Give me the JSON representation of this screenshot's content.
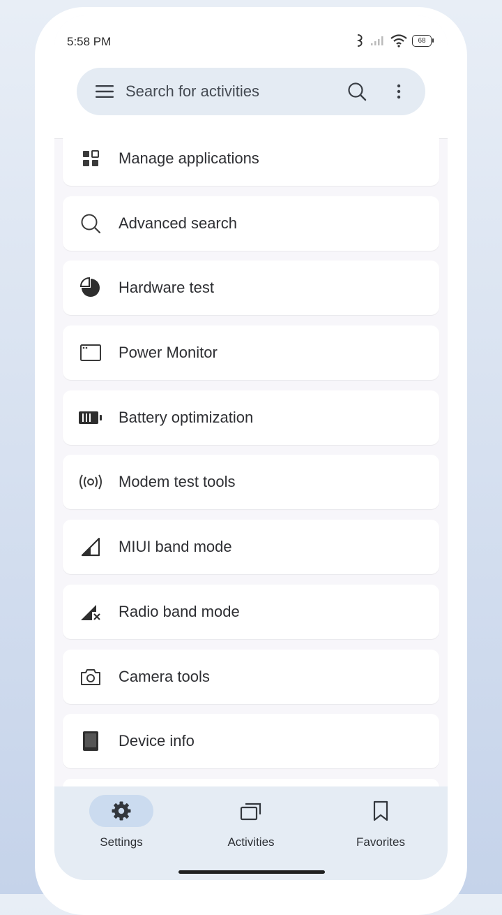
{
  "status": {
    "time": "5:58 PM",
    "battery": "68"
  },
  "search": {
    "placeholder": "Search for activities"
  },
  "list": [
    {
      "label": "Manage applications",
      "icon": "grid-icon"
    },
    {
      "label": "Advanced search",
      "icon": "search-icon"
    },
    {
      "label": "Hardware test",
      "icon": "pie-chart-icon"
    },
    {
      "label": "Power Monitor",
      "icon": "window-icon"
    },
    {
      "label": "Battery optimization",
      "icon": "battery-icon"
    },
    {
      "label": "Modem test tools",
      "icon": "broadcast-icon"
    },
    {
      "label": "MIUI band mode",
      "icon": "signal-icon"
    },
    {
      "label": "Radio band mode",
      "icon": "signal-off-icon"
    },
    {
      "label": "Camera tools",
      "icon": "camera-icon"
    },
    {
      "label": "Device info",
      "icon": "device-icon"
    }
  ],
  "nav": {
    "settings": "Settings",
    "activities": "Activities",
    "favorites": "Favorites"
  }
}
